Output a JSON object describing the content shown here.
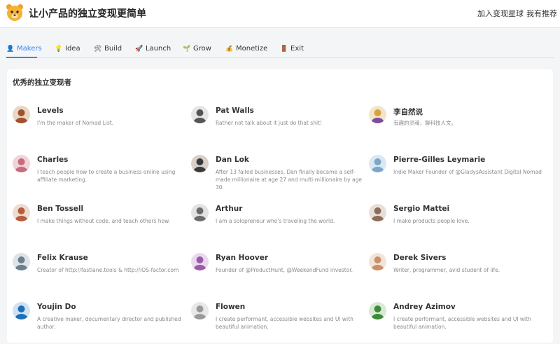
{
  "header": {
    "title": "让小产品的独立变现更简单",
    "links": [
      "加入变现星球",
      "我有推荐"
    ]
  },
  "tabs": [
    {
      "label": "Makers",
      "icon": "person-icon",
      "active": true
    },
    {
      "label": "Idea",
      "icon": "bulb-icon"
    },
    {
      "label": "Build",
      "icon": "tools-icon"
    },
    {
      "label": "Launch",
      "icon": "rocket-icon"
    },
    {
      "label": "Grow",
      "icon": "sprout-icon"
    },
    {
      "label": "Monetize",
      "icon": "money-bag-icon"
    },
    {
      "label": "Exit",
      "icon": "door-icon"
    }
  ],
  "section": {
    "title": "优秀的独立变现者"
  },
  "makers": [
    {
      "name": "Levels",
      "desc": "I'm the maker of Nomad List.",
      "color": "#a0522d"
    },
    {
      "name": "Pat Walls",
      "desc": "Rather not talk about it just do that shit!",
      "color": "#555555"
    },
    {
      "name": "李自然说",
      "desc": "有趣的灵魂，聊科技人文。",
      "color": "#d9a23b"
    },
    {
      "name": "Charles",
      "desc": "I teach people how to create a business online using affiliate marketing.",
      "color": "#c86b7c"
    },
    {
      "name": "Dan Lok",
      "desc": "After 13 failed businesses, Dan finally became a self-made millionaire at age 27 and multi-millionaire by age 30.",
      "color": "#3a3a3a"
    },
    {
      "name": "Pierre-Gilles Leymarie",
      "desc": "Indie Maker Founder of @GladysAssistant Digital Nomad",
      "color": "#7ea6c9"
    },
    {
      "name": "Ben Tossell",
      "desc": "I make things without code, and teach others how.",
      "color": "#b85c3c"
    },
    {
      "name": "Arthur",
      "desc": "I am a solopreneur who's traveling the world.",
      "color": "#6b6b6b"
    },
    {
      "name": "Sergio Mattei",
      "desc": "I make products people love.",
      "color": "#8c6d5a"
    },
    {
      "name": "Felix Krause",
      "desc": "Creator of http://fastlane.tools & http://iOS-factor.com",
      "color": "#6d7f8f"
    },
    {
      "name": "Ryan Hoover",
      "desc": "Founder of @ProductHunt, @WeekendFund investor.",
      "color": "#9a5aa8"
    },
    {
      "name": "Derek Sivers",
      "desc": "Writer, programmer, avid student of life.",
      "color": "#c9906a"
    },
    {
      "name": "Youjin Do",
      "desc": "A creative maker, documentary director and published author.",
      "color": "#1d6fb8"
    },
    {
      "name": "Flowen",
      "desc": "I create performant, accessible websites and UI with beautiful animation.",
      "color": "#9a9a9a"
    },
    {
      "name": "Andrey  Azimov",
      "desc": "I create performant, accessible websites and UI with beautiful animation.",
      "color": "#3f8a3a"
    }
  ]
}
